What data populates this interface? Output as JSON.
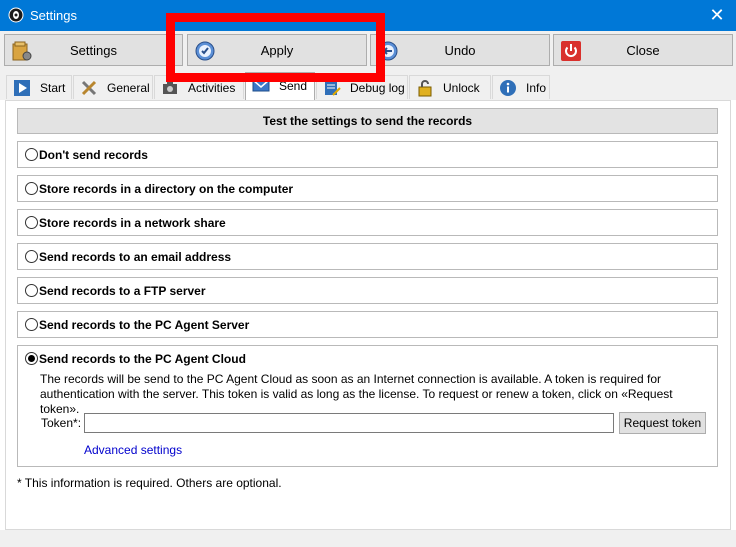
{
  "window": {
    "title": "Settings",
    "close_glyph": "✕"
  },
  "toolbar": {
    "settings_label": "Settings",
    "apply_label": "Apply",
    "undo_label": "Undo",
    "close_label": "Close"
  },
  "tabs": [
    {
      "label": "Start",
      "icon": "play-icon"
    },
    {
      "label": "General",
      "icon": "tools-icon"
    },
    {
      "label": "Activities",
      "icon": "camera-icon"
    },
    {
      "label": "Send",
      "icon": "send-icon",
      "active": true
    },
    {
      "label": "Debug log",
      "icon": "debug-log-icon"
    },
    {
      "label": "Unlock",
      "icon": "padlock-icon"
    },
    {
      "label": "Info",
      "icon": "info-icon"
    }
  ],
  "send": {
    "header": "Test the settings to send the records",
    "options": [
      "Don't send records",
      "Store records in a directory on the computer",
      "Store records in a network share",
      "Send records to an email address",
      "Send records to a FTP server",
      "Send records to the PC Agent Server",
      "Send records to the PC Agent Cloud"
    ],
    "selected_option": "Send records to the PC Agent Cloud",
    "cloud_description": "The records will be send to the PC Agent Cloud as soon as an Internet connection is available. A token is required for authentication with the server. This token is valid as long as the license. To request or renew a token, click on «Request token».",
    "token_label": "Token*:",
    "token_value": "",
    "request_token_label": "Request token",
    "advanced_settings_label": "Advanced settings"
  },
  "footnote": "* This information is required. Others are optional.",
  "colors": {
    "titlebar": "#0078d7",
    "highlight": "#ff0000",
    "link": "#0000cd"
  }
}
